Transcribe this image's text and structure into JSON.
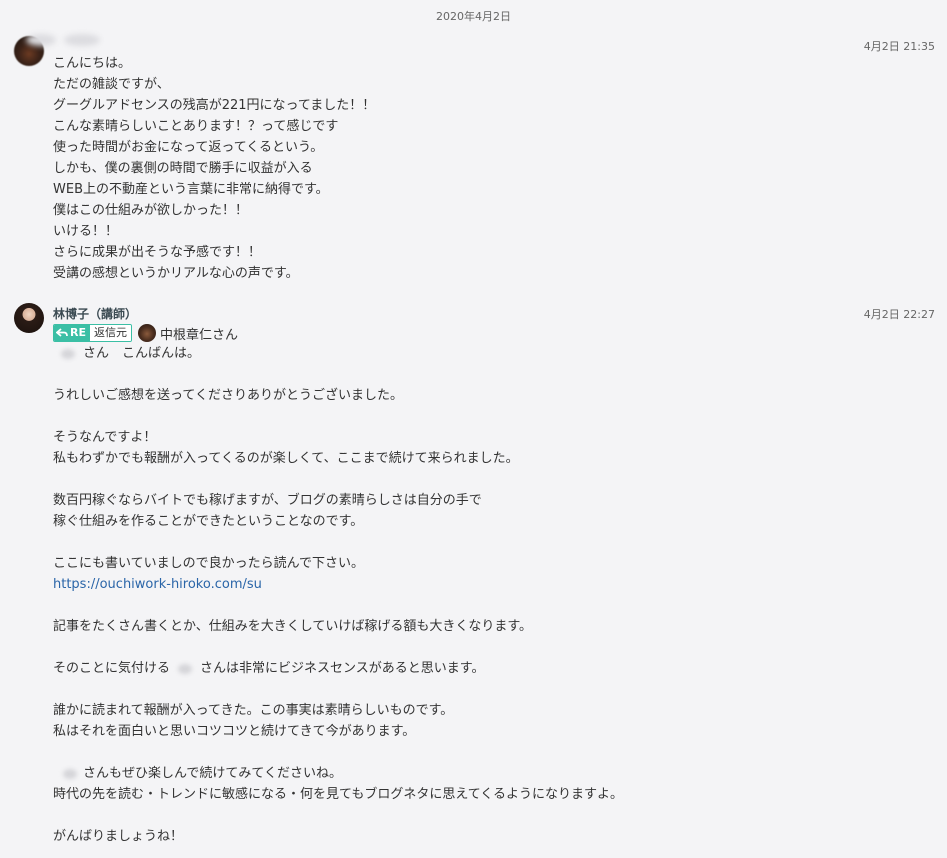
{
  "date_divider": "2020年4月2日",
  "messages": [
    {
      "sender_name": "",
      "time": "4月2日 21:35",
      "lines": [
        "こんにちは。",
        "ただの雑談ですが、",
        "グーグルアドセンスの残高が221円になってました！！",
        "こんな素晴らしいことあります！？って感じです",
        "使った時間がお金になって返ってくるという。",
        "しかも、僕の裏側の時間で勝手に収益が入る",
        "WEB上の不動産という言葉に非常に納得です。",
        "僕はこの仕組みが欲しかった！！",
        "いける！！",
        "さらに成果が出そうな予感です！！",
        "受講の感想というかリアルな心の声です。"
      ]
    },
    {
      "sender_name": "林博子（講師）",
      "time": "4月2日 22:27",
      "reply": {
        "badge": "RE",
        "source_label": "返信元",
        "to_name": "中根章仁さん"
      },
      "lines": {
        "l1": "さん　こんばんは。",
        "l2": "",
        "l3": "うれしいご感想を送ってくださりありがとうございました。",
        "l4": "",
        "l5": "そうなんですよ！",
        "l6": "私もわずかでも報酬が入ってくるのが楽しくて、ここまで続けて来られました。",
        "l7": "",
        "l8": "数百円稼ぐならバイトでも稼げますが、ブログの素晴らしさは自分の手で",
        "l9": "稼ぐ仕組みを作ることができたということなのです。",
        "l10": "",
        "l11": "ここにも書いていましので良かったら読んで下さい。",
        "l12": "https://ouchiwork-hiroko.com/su",
        "l13": "",
        "l14": "記事をたくさん書くとか、仕組みを大きくしていけば稼げる額も大きくなります。",
        "l15": "",
        "l16_a": "そのことに気付ける",
        "l16_b": "さんは非常にビジネスセンスがあると思います。",
        "l17": "",
        "l18": "誰かに読まれて報酬が入ってきた。この事実は素晴らしいものです。",
        "l19": "私はそれを面白いと思いコツコツと続けてきて今があります。",
        "l20": "",
        "l21": "さんもぜひ楽しんで続けてみてくださいね。",
        "l22": "時代の先を読む・トレンドに敏感になる・何を見てもブログネタに思えてくるようになりますよ。",
        "l23": "",
        "l24": "がんばりましょうね！"
      }
    }
  ],
  "colors": {
    "background": "#f4f4f6",
    "link": "#2a65a8",
    "reply_badge": "#3bbfa5"
  },
  "icons": {
    "reply_arrow": "reply-arrow-icon"
  }
}
